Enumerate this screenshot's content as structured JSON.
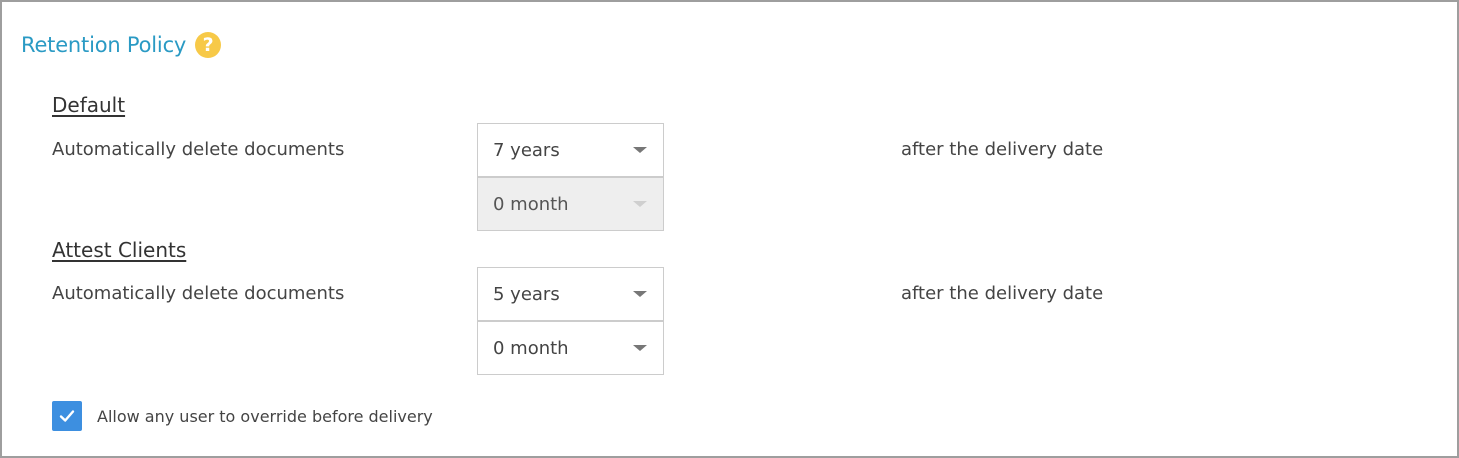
{
  "retention": {
    "title": "Retention Policy",
    "help_icon": "help-circle-icon",
    "help_glyph": "?",
    "accent_color": "#2a9ac4",
    "help_color": "#f7c948",
    "sections": [
      {
        "heading": "Default",
        "row_label": "Automatically delete documents",
        "years_value": "7 years",
        "months_value": "0 month",
        "months_disabled": true,
        "suffix": "after the delivery date"
      },
      {
        "heading": "Attest Clients",
        "row_label": "Automatically delete documents",
        "years_value": "5 years",
        "months_value": "0 month",
        "months_disabled": false,
        "suffix": "after the delivery date"
      }
    ],
    "override": {
      "label": "Allow any user to override before delivery",
      "checked": true,
      "icon": "checkmark-icon",
      "checkbox_color": "#3d8fe0"
    }
  }
}
